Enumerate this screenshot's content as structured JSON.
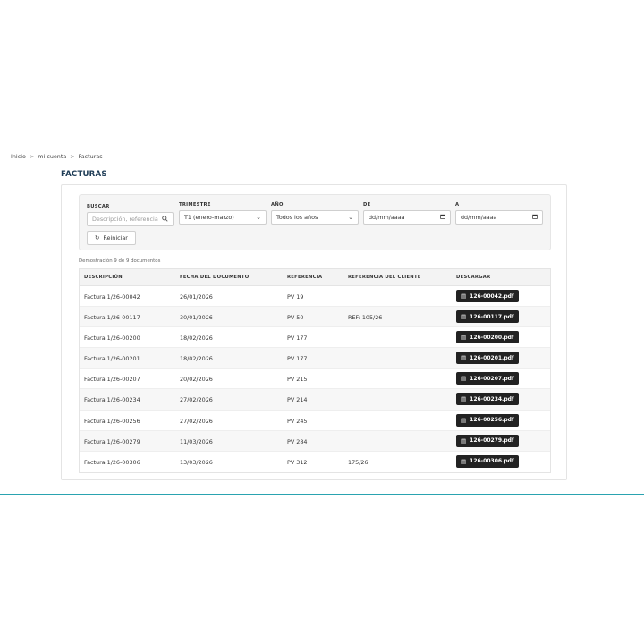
{
  "breadcrumb": {
    "items": [
      "Inicio",
      "mi cuenta",
      "Facturas"
    ],
    "separator": ">"
  },
  "page_title": "FACTURAS",
  "filters": {
    "search": {
      "label": "BUSCAR",
      "placeholder": "Descripción, referencia",
      "icon": "search-icon"
    },
    "quarter": {
      "label": "TRIMESTRE",
      "value": "T1 (enero-marzo)"
    },
    "year": {
      "label": "AÑO",
      "value": "Todos los años"
    },
    "from": {
      "label": "DE",
      "placeholder": "dd/mm/aaaa"
    },
    "to": {
      "label": "A",
      "placeholder": "dd/mm/aaaa"
    },
    "reset_label": "Reiniciar"
  },
  "doc_count": "Demostración 9 de 9 documentos",
  "table": {
    "columns": [
      "DESCRIPCIÓN",
      "FECHA DEL DOCUMENTO",
      "REFERENCIA",
      "REFERENCIA DEL CLIENTE",
      "DESCARGAR"
    ],
    "rows": [
      {
        "description": "Factura 1/26-00042",
        "date": "26/01/2026",
        "reference": "PV 19",
        "client_reference": "",
        "file": "126-00042.pdf"
      },
      {
        "description": "Factura 1/26-00117",
        "date": "30/01/2026",
        "reference": "PV 50",
        "client_reference": "REF: 105/26",
        "file": "126-00117.pdf"
      },
      {
        "description": "Factura 1/26-00200",
        "date": "18/02/2026",
        "reference": "PV 177",
        "client_reference": "",
        "file": "126-00200.pdf"
      },
      {
        "description": "Factura 1/26-00201",
        "date": "18/02/2026",
        "reference": "PV 177",
        "client_reference": "",
        "file": "126-00201.pdf"
      },
      {
        "description": "Factura 1/26-00207",
        "date": "20/02/2026",
        "reference": "PV 215",
        "client_reference": "",
        "file": "126-00207.pdf"
      },
      {
        "description": "Factura 1/26-00234",
        "date": "27/02/2026",
        "reference": "PV 214",
        "client_reference": "",
        "file": "126-00234.pdf"
      },
      {
        "description": "Factura 1/26-00256",
        "date": "27/02/2026",
        "reference": "PV 245",
        "client_reference": "",
        "file": "126-00256.pdf"
      },
      {
        "description": "Factura 1/26-00279",
        "date": "11/03/2026",
        "reference": "PV 284",
        "client_reference": "",
        "file": "126-00279.pdf"
      },
      {
        "description": "Factura 1/26-00306",
        "date": "13/03/2026",
        "reference": "PV 312",
        "client_reference": "175/26",
        "file": "126-00306.pdf"
      }
    ]
  },
  "colors": {
    "title": "#1f3d57",
    "button_dark": "#222222",
    "accent_line": "#2aa3b0"
  }
}
